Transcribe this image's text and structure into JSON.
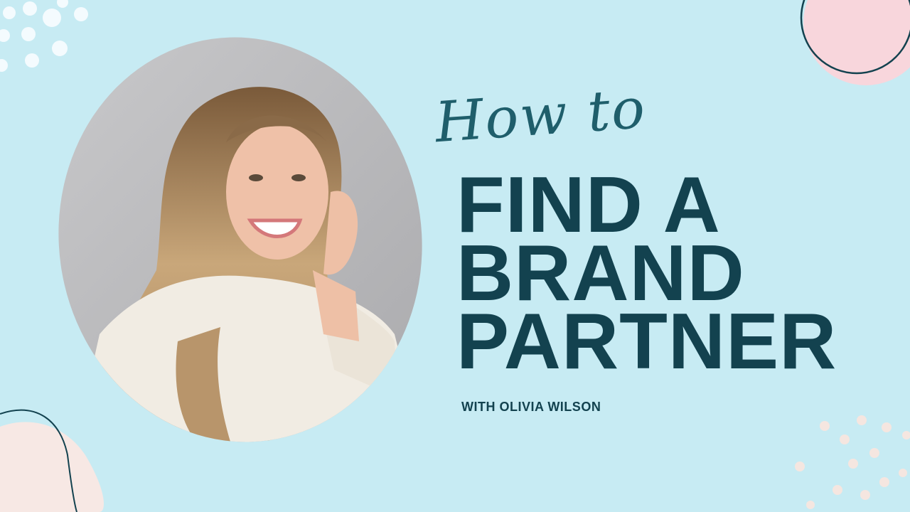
{
  "script_title": "How to",
  "headline": {
    "line1": "FIND A",
    "line2": "BRAND",
    "line3": "PARTNER"
  },
  "subtitle": "WITH OLIVIA WILSON",
  "colors": {
    "background": "#c7ebf3",
    "heading": "#13424f",
    "script": "#1f5e6b",
    "pink_circle": "#f8d6dc",
    "peach_blob": "#f7e8e4",
    "dots": "#f5fbfe"
  },
  "photo": {
    "subject": "smiling woman with long wavy hair in a white knit sweater"
  }
}
